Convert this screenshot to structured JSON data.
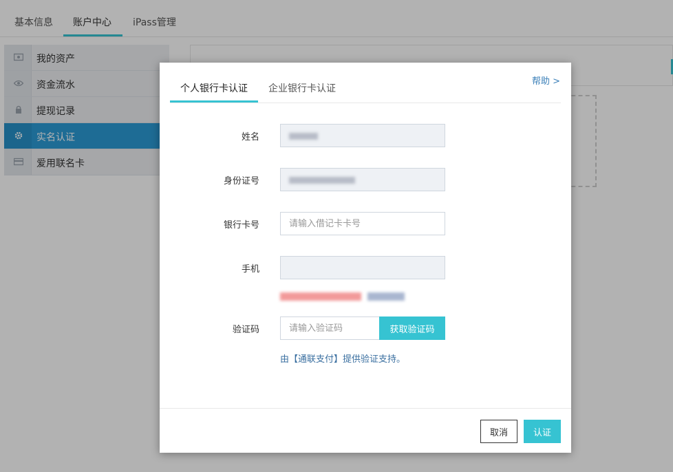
{
  "top_tabs": [
    {
      "label": "基本信息"
    },
    {
      "label": "账户中心"
    },
    {
      "label": "iPass管理"
    }
  ],
  "sidebar": {
    "items": [
      {
        "label": "我的资产",
        "icon": "cash-icon"
      },
      {
        "label": "资金流水",
        "icon": "eye-icon"
      },
      {
        "label": "提现记录",
        "icon": "lock-icon"
      },
      {
        "label": "实名认证",
        "icon": "gear-icon",
        "active": true
      },
      {
        "label": "爱用联名卡",
        "icon": "card-icon"
      }
    ]
  },
  "modal": {
    "tabs": [
      {
        "label": "个人银行卡认证"
      },
      {
        "label": "企业银行卡认证"
      }
    ],
    "help_label": "帮助 >",
    "fields": {
      "name": {
        "label": "姓名"
      },
      "id_number": {
        "label": "身份证号"
      },
      "bank_card": {
        "label": "银行卡号",
        "placeholder": "请输入借记卡卡号"
      },
      "phone": {
        "label": "手机"
      },
      "code": {
        "label": "验证码",
        "placeholder": "请输入验证码",
        "button_label": "获取验证码"
      }
    },
    "tip": "由【通联支付】提供验证支持。",
    "cancel_label": "取消",
    "confirm_label": "认证"
  },
  "colors": {
    "accent": "#36c3d2",
    "sidebar_active": "#2b9bd6",
    "link": "#3a7fb8"
  }
}
